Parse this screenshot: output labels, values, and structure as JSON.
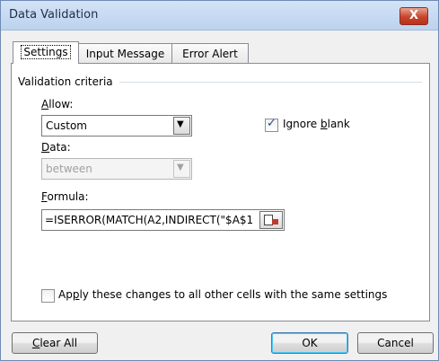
{
  "window": {
    "title": "Data Validation",
    "close_glyph": "X"
  },
  "tabs": {
    "settings": "Settings",
    "input_message": "Input Message",
    "error_alert": "Error Alert"
  },
  "settings": {
    "group_label": "Validation criteria",
    "allow_label": {
      "key": "A",
      "rest": "llow:"
    },
    "allow_value": "Custom",
    "ignore_blank": {
      "pre": "Ignore ",
      "key": "b",
      "rest": "lank",
      "checked": true
    },
    "data_label": {
      "key": "D",
      "rest": "ata:"
    },
    "data_value": "between",
    "formula_label": {
      "key": "F",
      "rest": "ormula:"
    },
    "formula_value": "=ISERROR(MATCH(A2,INDIRECT(\"$A$1",
    "apply_all": {
      "pre": "Ap",
      "key": "p",
      "rest": "ly these changes to all other cells with the same settings",
      "checked": false
    }
  },
  "buttons": {
    "clear_all": {
      "key": "C",
      "rest": "lear All"
    },
    "ok": "OK",
    "cancel": "Cancel"
  },
  "icons": {
    "dropdown": "chevron-down-icon",
    "range_select": "range-select-icon",
    "close": "close-icon"
  }
}
